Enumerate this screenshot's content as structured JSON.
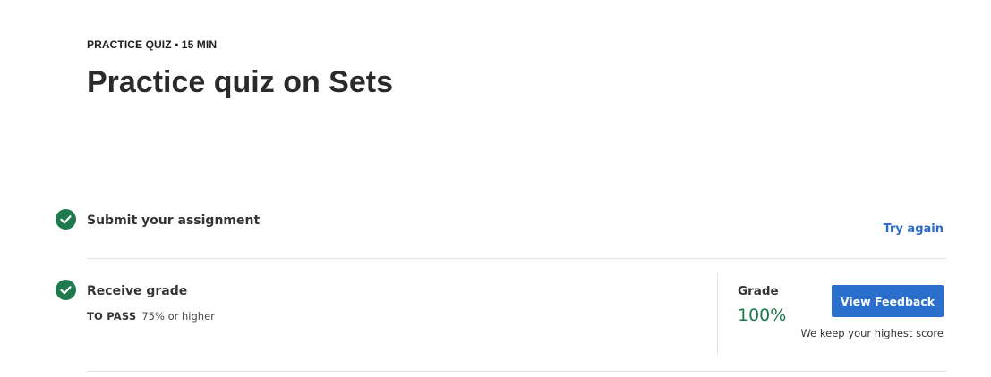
{
  "header": {
    "eyebrow": "PRACTICE QUIZ • 15 MIN",
    "title": "Practice quiz on Sets"
  },
  "steps": [
    {
      "title": "Submit your assignment",
      "icon": "check-circle-icon",
      "action_label": "Try again"
    },
    {
      "title": "Receive grade",
      "icon": "check-circle-icon",
      "to_pass_label": "TO PASS",
      "to_pass_value": "75% or higher"
    }
  ],
  "grade": {
    "label": "Grade",
    "value": "100%",
    "button_label": "View Feedback",
    "note": "We keep your highest score"
  },
  "colors": {
    "success": "#1e7a4c",
    "link": "#2a6bc7",
    "button": "#2a6fcb"
  }
}
